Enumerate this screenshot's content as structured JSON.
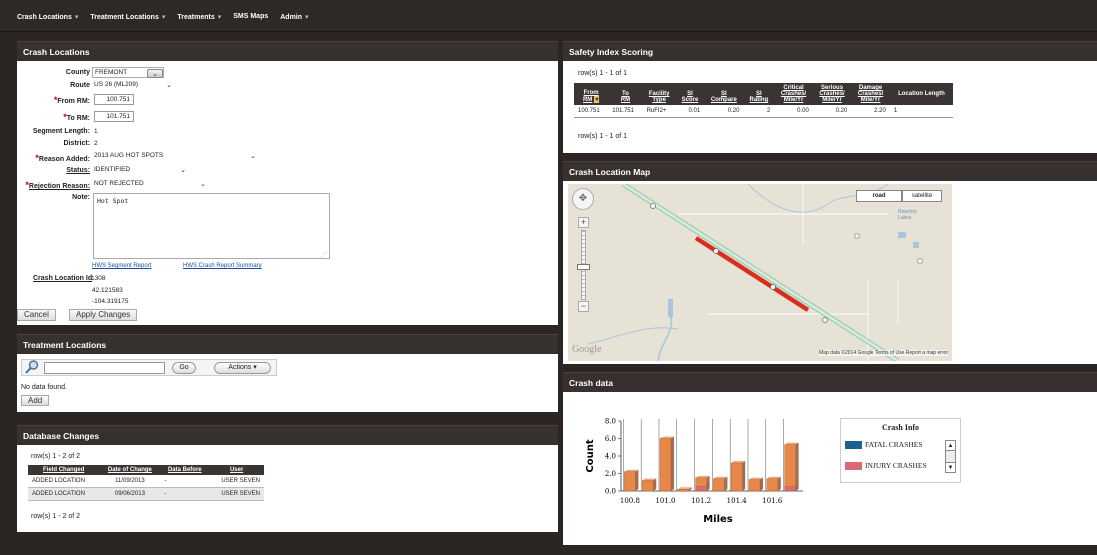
{
  "nav": [
    {
      "label": "Crash Locations",
      "caret": "▾"
    },
    {
      "label": "Treatment Locations",
      "caret": "▾"
    },
    {
      "label": "Treatments",
      "caret": "▾"
    },
    {
      "label": "SMS Maps",
      "caret": ""
    },
    {
      "label": "Admin",
      "caret": "▾"
    }
  ],
  "crash_locations": {
    "title": "Crash Locations",
    "county_label": "County",
    "county_value": "FREMONT",
    "route_label": "Route",
    "route_value": "US 26 (ML209)",
    "from_rm_label": "From RM:",
    "from_rm_value": "100.751",
    "to_rm_label": "To RM:",
    "to_rm_value": "101.751",
    "segment_length_label": "Segment Length:",
    "segment_length_value": "1",
    "district_label": "District:",
    "district_value": "2",
    "reason_added_label": "Reason Added:",
    "reason_added_value": "2013 AUG HOT SPOTS",
    "status_label": "Status:",
    "status_value": "IDENTIFIED",
    "rejection_reason_label": "Rejection Reason:",
    "rejection_reason_value": "NOT REJECTED",
    "note_label": "Note:",
    "note_value": "Hot Spot",
    "link_segment_report": "HWS Segment Report",
    "link_crash_summary": "HWS Crash Report Summary",
    "crash_location_id_label": "Crash Location Id",
    "crash_location_id_value": "1308",
    "latitude": "42.121583",
    "longitude": "-104.319175",
    "cancel_label": "Cancel",
    "apply_label": "Apply Changes"
  },
  "treatment_locations": {
    "title": "Treatment Locations",
    "search_value": "",
    "go_label": "Go",
    "actions_label": "Actions",
    "no_data": "No data found.",
    "add_label": "Add"
  },
  "database_changes": {
    "title": "Database Changes",
    "rows_top": "row(s) 1 - 2 of 2",
    "rows_bottom": "row(s) 1 - 2 of 2",
    "headers": [
      "Field Changed",
      "Date of Change",
      "Data Before",
      "User"
    ],
    "rows": [
      [
        "ADDED LOCATION",
        "11/09/2013",
        "-",
        "USER SEVEN"
      ],
      [
        "ADDED LOCATION",
        "09/06/2013",
        "-",
        "USER SEVEN"
      ]
    ]
  },
  "safety": {
    "title": "Safety Index Scoring",
    "rows_top": "row(s) 1 - 1 of 1",
    "rows_bottom": "row(s) 1 - 1 of 1",
    "headers": [
      [
        "From",
        "RM"
      ],
      [
        "To",
        "RM"
      ],
      [
        "Facility",
        "Type"
      ],
      [
        "SI",
        "Score"
      ],
      [
        "SI",
        "Compare"
      ],
      [
        "SI",
        "Rating"
      ],
      [
        "Critical",
        "Crashes/",
        "Mile/Yr"
      ],
      [
        "Serious",
        "Crashes/",
        "Mile/Yr"
      ],
      [
        "Damage",
        "Crashes/",
        "Mile/Yr"
      ],
      [
        "Location Length"
      ]
    ],
    "row": [
      "100.751",
      "101.751",
      "RuFI2+",
      "0.01",
      "0.20",
      "2",
      "0.00",
      "0.20",
      "2.20",
      "1"
    ]
  },
  "map": {
    "title": "Crash Location Map",
    "road_label": "road",
    "satellite_label": "satellite",
    "place": "Riverton Lakes",
    "google_logo": "Google",
    "attribution": "Map data ©2014 Google   Terms of Use   Report a map error"
  },
  "crash_data": {
    "title": "Crash data",
    "legend_title": "Crash Info",
    "legend": [
      {
        "label": "FATAL CRASHES",
        "color": "#1f5f8b"
      },
      {
        "label": "INJURY CRASHES",
        "color": "#d9687a"
      }
    ]
  },
  "chart_data": {
    "type": "bar",
    "xlabel": "Miles",
    "ylabel": "Count",
    "ylim": [
      0,
      8
    ],
    "yticks": [
      "0.0",
      "2.0",
      "4.0",
      "6.0",
      "8.0"
    ],
    "xticks": [
      "100.8",
      "101.0",
      "101.2",
      "101.4",
      "101.6"
    ],
    "x": [
      100.8,
      100.9,
      101.0,
      101.1,
      101.2,
      101.3,
      101.4,
      101.5,
      101.6,
      101.7
    ],
    "series": [
      {
        "name": "FATAL CRASHES",
        "color": "#1f5f8b",
        "values": [
          0,
          0,
          0,
          0,
          0,
          0,
          0,
          0,
          0,
          0
        ]
      },
      {
        "name": "INJURY CRASHES",
        "color": "#d9687a",
        "values": [
          0,
          0,
          0,
          0,
          0.5,
          0,
          0,
          0,
          0,
          0.5
        ]
      },
      {
        "name": "",
        "color": "#e8874a",
        "values": [
          2.2,
          1.2,
          6.0,
          0.2,
          1.0,
          1.4,
          3.2,
          1.3,
          1.4,
          4.8
        ]
      }
    ],
    "grid": false,
    "legend_position": "right"
  }
}
